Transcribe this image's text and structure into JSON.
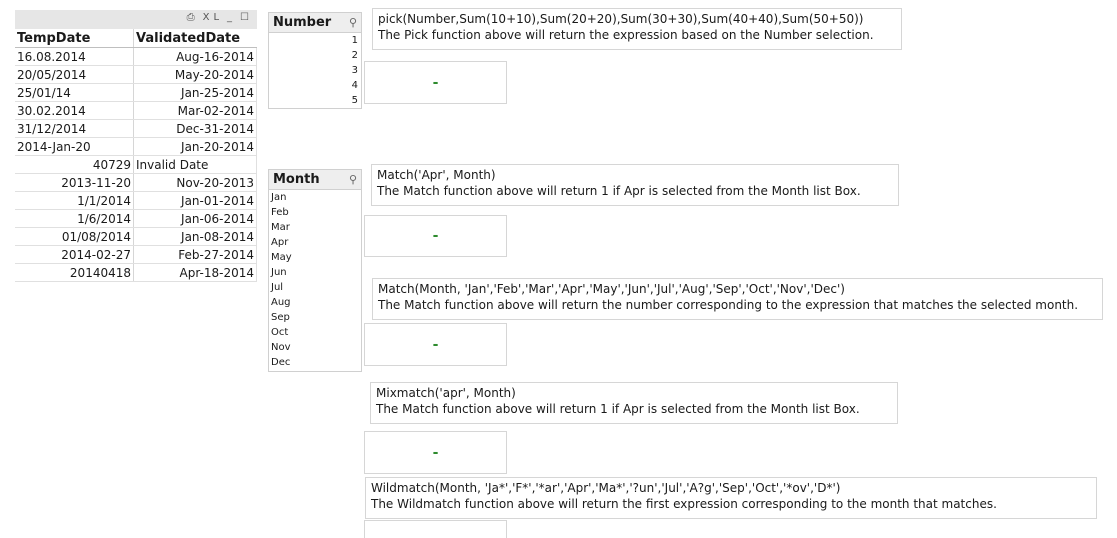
{
  "table": {
    "caption_icons": [
      "⎙",
      "XL",
      "_",
      "☐"
    ],
    "headers": [
      "TempDate",
      "ValidatedDate"
    ],
    "rows": [
      [
        "16.08.2014",
        "Aug-16-2014"
      ],
      [
        "20/05/2014",
        "May-20-2014"
      ],
      [
        "25/01/14",
        "Jan-25-2014"
      ],
      [
        "30.02.2014",
        "Mar-02-2014"
      ],
      [
        "31/12/2014",
        "Dec-31-2014"
      ],
      [
        "2014-Jan-20",
        "Jan-20-2014"
      ],
      [
        "40729",
        "Invalid Date"
      ],
      [
        "2013-11-20",
        "Nov-20-2013"
      ],
      [
        "1/1/2014",
        "Jan-01-2014"
      ],
      [
        "1/6/2014",
        "Jan-06-2014"
      ],
      [
        "01/08/2014",
        "Jan-08-2014"
      ],
      [
        "2014-02-27",
        "Feb-27-2014"
      ],
      [
        "20140418",
        "Apr-18-2014"
      ]
    ]
  },
  "number_list": {
    "title": "Number",
    "items": [
      "1",
      "2",
      "3",
      "4",
      "5"
    ]
  },
  "month_list": {
    "title": "Month",
    "items": [
      "Jan",
      "Feb",
      "Mar",
      "Apr",
      "May",
      "Jun",
      "Jul",
      "Aug",
      "Sep",
      "Oct",
      "Nov",
      "Dec"
    ]
  },
  "boxes": {
    "pick_expr": "pick(Number,Sum(10+10),Sum(20+20),Sum(30+30),Sum(40+40),Sum(50+50))",
    "pick_desc": "The Pick function above will return the expression based on the Number selection.",
    "match1_expr": "Match('Apr', Month)",
    "match1_desc": "The Match function above will return 1 if Apr is selected from the Month list Box.",
    "match2_expr": "Match(Month,  'Jan','Feb','Mar','Apr','May','Jun','Jul','Aug','Sep','Oct','Nov','Dec')",
    "match2_desc": "The Match function above will return the number corresponding to the expression that matches the selected month.",
    "mix_expr": "Mixmatch('apr', Month)",
    "mix_desc": "The Match function above will return 1 if Apr is selected from the Month list Box.",
    "wild_expr": "Wildmatch(Month,  'Ja*','F*','*ar','Apr','Ma*','?un','Jul','A?g','Sep','Oct','*ov','D*')",
    "wild_desc": "The Wildmatch function above will return the first expression corresponding to the month that matches.",
    "result": "-"
  }
}
